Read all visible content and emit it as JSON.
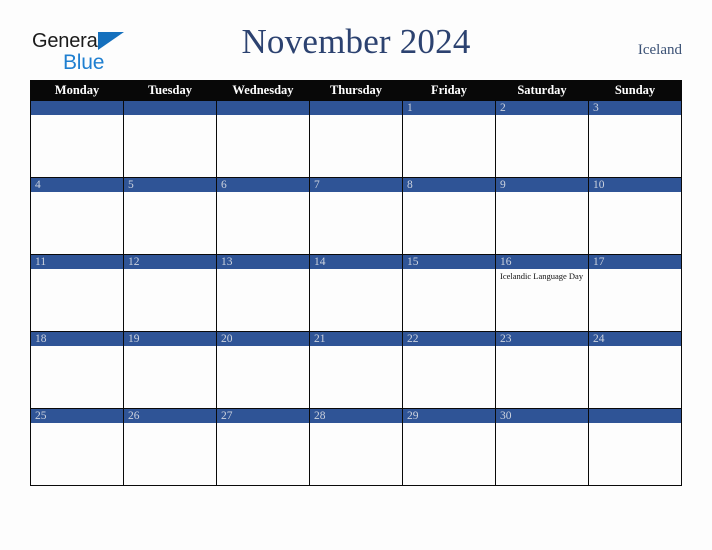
{
  "brand": {
    "name_part1": "General",
    "name_part2": "Blue",
    "triangle_color": "#1570bd",
    "blue_color": "#1f7fd0"
  },
  "header": {
    "title": "November 2024",
    "country": "Iceland",
    "title_color": "#2c4270"
  },
  "colors": {
    "weekday_header_bg": "#080808",
    "date_bar_bg": "#2f5496",
    "date_text": "#ccd2de",
    "page_bg": "#fdfdfd",
    "grid_border": "#0a0a0a"
  },
  "calendar": {
    "month": "November",
    "year": "2024",
    "weekdays": [
      "Monday",
      "Tuesday",
      "Wednesday",
      "Thursday",
      "Friday",
      "Saturday",
      "Sunday"
    ],
    "weeks": [
      [
        {
          "date": "",
          "events": []
        },
        {
          "date": "",
          "events": []
        },
        {
          "date": "",
          "events": []
        },
        {
          "date": "",
          "events": []
        },
        {
          "date": "1",
          "events": []
        },
        {
          "date": "2",
          "events": []
        },
        {
          "date": "3",
          "events": []
        }
      ],
      [
        {
          "date": "4",
          "events": []
        },
        {
          "date": "5",
          "events": []
        },
        {
          "date": "6",
          "events": []
        },
        {
          "date": "7",
          "events": []
        },
        {
          "date": "8",
          "events": []
        },
        {
          "date": "9",
          "events": []
        },
        {
          "date": "10",
          "events": []
        }
      ],
      [
        {
          "date": "11",
          "events": []
        },
        {
          "date": "12",
          "events": []
        },
        {
          "date": "13",
          "events": []
        },
        {
          "date": "14",
          "events": []
        },
        {
          "date": "15",
          "events": []
        },
        {
          "date": "16",
          "events": [
            "Icelandic Language Day"
          ]
        },
        {
          "date": "17",
          "events": []
        }
      ],
      [
        {
          "date": "18",
          "events": []
        },
        {
          "date": "19",
          "events": []
        },
        {
          "date": "20",
          "events": []
        },
        {
          "date": "21",
          "events": []
        },
        {
          "date": "22",
          "events": []
        },
        {
          "date": "23",
          "events": []
        },
        {
          "date": "24",
          "events": []
        }
      ],
      [
        {
          "date": "25",
          "events": []
        },
        {
          "date": "26",
          "events": []
        },
        {
          "date": "27",
          "events": []
        },
        {
          "date": "28",
          "events": []
        },
        {
          "date": "29",
          "events": []
        },
        {
          "date": "30",
          "events": []
        },
        {
          "date": "",
          "events": []
        }
      ]
    ]
  }
}
